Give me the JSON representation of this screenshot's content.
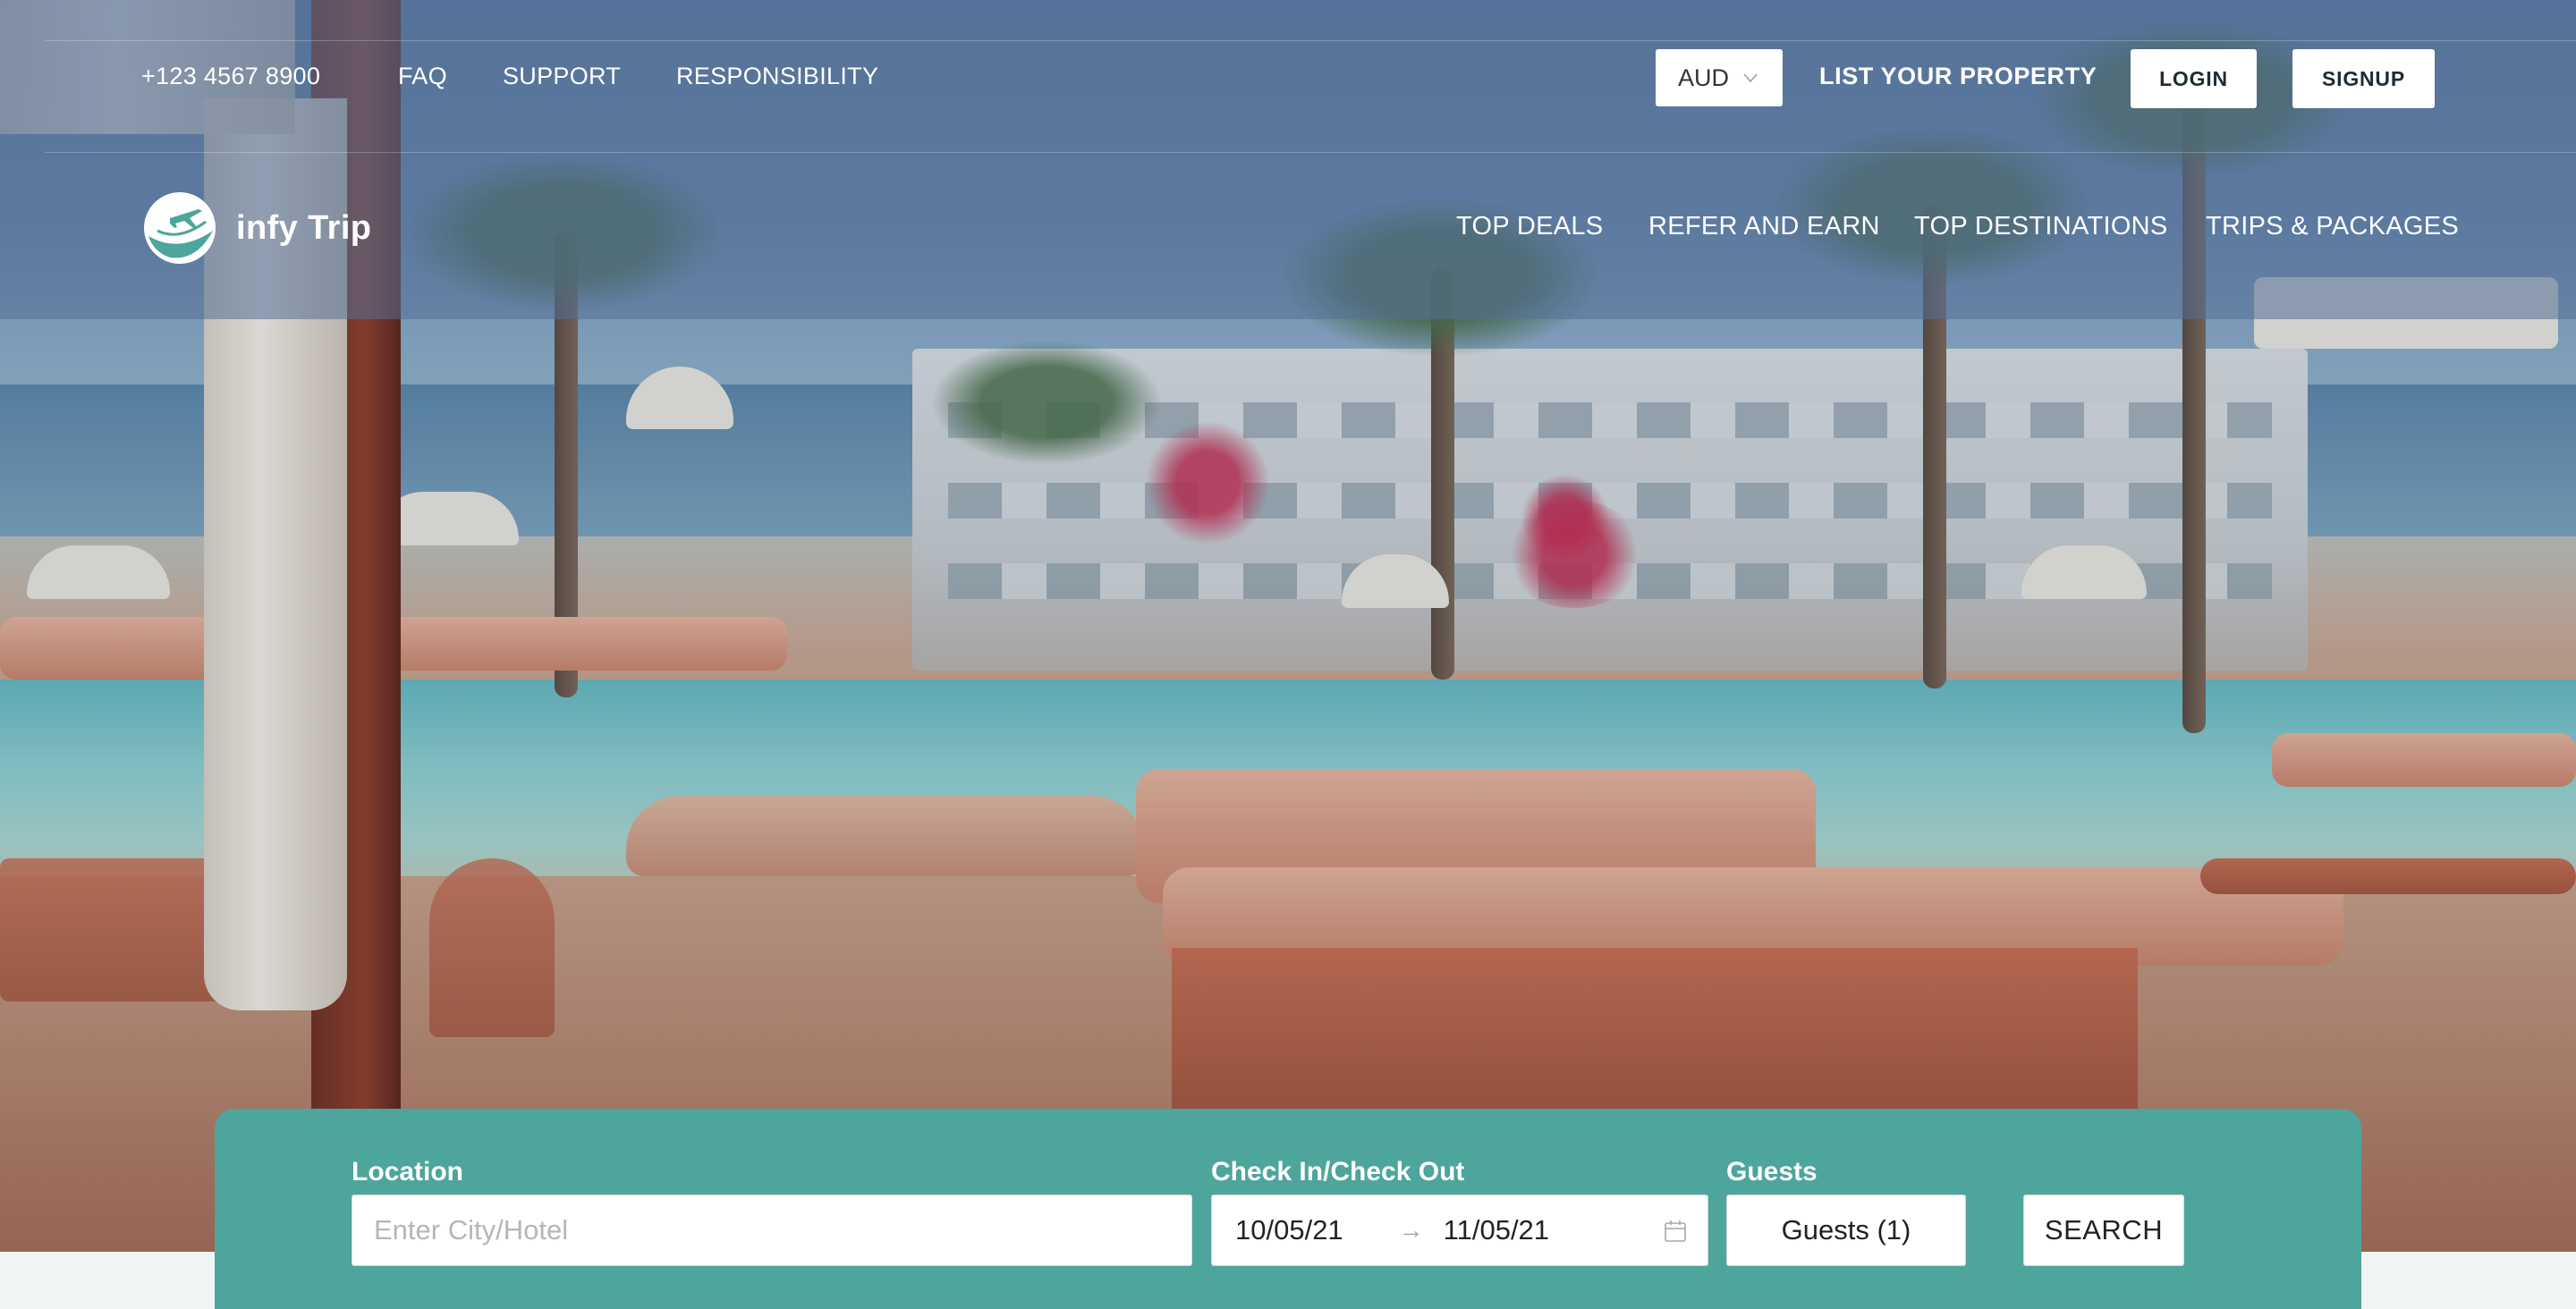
{
  "topbar": {
    "phone": "+123 4567 8900",
    "links": [
      "FAQ",
      "SUPPORT",
      "RESPONSIBILITY"
    ],
    "currency": "AUD",
    "list_property": "LIST YOUR PROPERTY",
    "login": "LOGIN",
    "signup": "SIGNUP"
  },
  "brand": {
    "name": "infy Trip",
    "logo_icon": "airplane-globe-icon"
  },
  "nav": [
    "TOP DEALS",
    "REFER AND EARN",
    "TOP DESTINATIONS",
    "TRIPS & PACKAGES"
  ],
  "search": {
    "location_label": "Location",
    "location_placeholder": "Enter City/Hotel",
    "location_value": "",
    "dates_label": "Check In/Check Out",
    "check_in": "10/05/21",
    "check_out": "11/05/21",
    "date_arrow": "→",
    "calendar_icon": "calendar-icon",
    "guests_label": "Guests",
    "guests_value": "Guests (1)",
    "search_label": "SEARCH"
  },
  "colors": {
    "accent": "#4da59b",
    "header_overlay": "#56709a",
    "page_bg": "#f1f4f5"
  }
}
